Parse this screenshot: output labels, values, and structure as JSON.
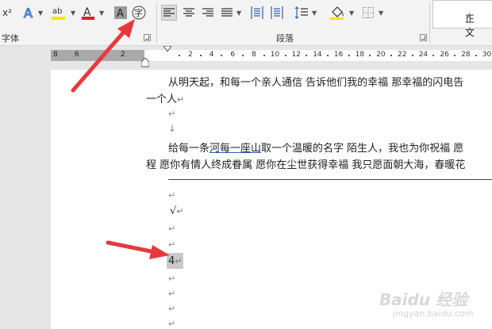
{
  "ribbon": {
    "font_group_label": "字体",
    "paragraph_group_label": "段落",
    "style_normal_label": "正文",
    "superscript_label": "x²",
    "font_color_letter": "A",
    "char_shading_letter": "A",
    "phonetic_guide_glyph": "字",
    "highlight_label": "ab"
  },
  "ruler": {
    "left_numbers": [
      "8",
      "6",
      "2"
    ],
    "right_numbers": [
      "2",
      "4",
      "6",
      "8",
      "10",
      "12",
      "14",
      "16",
      "18",
      "20",
      "22",
      "24",
      "26",
      "28",
      "30"
    ]
  },
  "document": {
    "line1": "从明天起，和每一个亲人通信  告诉他们我的幸福  那幸福的闪电告",
    "line2": "一个人",
    "line3_a": "给每一条",
    "line3_link": "河每一座山",
    "line3_b": "取一个温暖的名字  陌生人，我也为你祝福  愿",
    "line4": "程  愿你有情人终成眷属  愿你在尘世获得幸福  我只愿面朝大海，春暖花",
    "checkmark": "√",
    "number_four": "4",
    "down_arrow": "↓",
    "para_mark": "↵"
  },
  "watermark": {
    "logo_text": "Baidu 经验",
    "url_text": "jingyan.baidu.com"
  },
  "colors": {
    "accent_arrow": "#e8383d",
    "font_color_red": "#e01f1f",
    "highlight_yellow": "#f7e600",
    "link_underline": "#2a5db0"
  }
}
